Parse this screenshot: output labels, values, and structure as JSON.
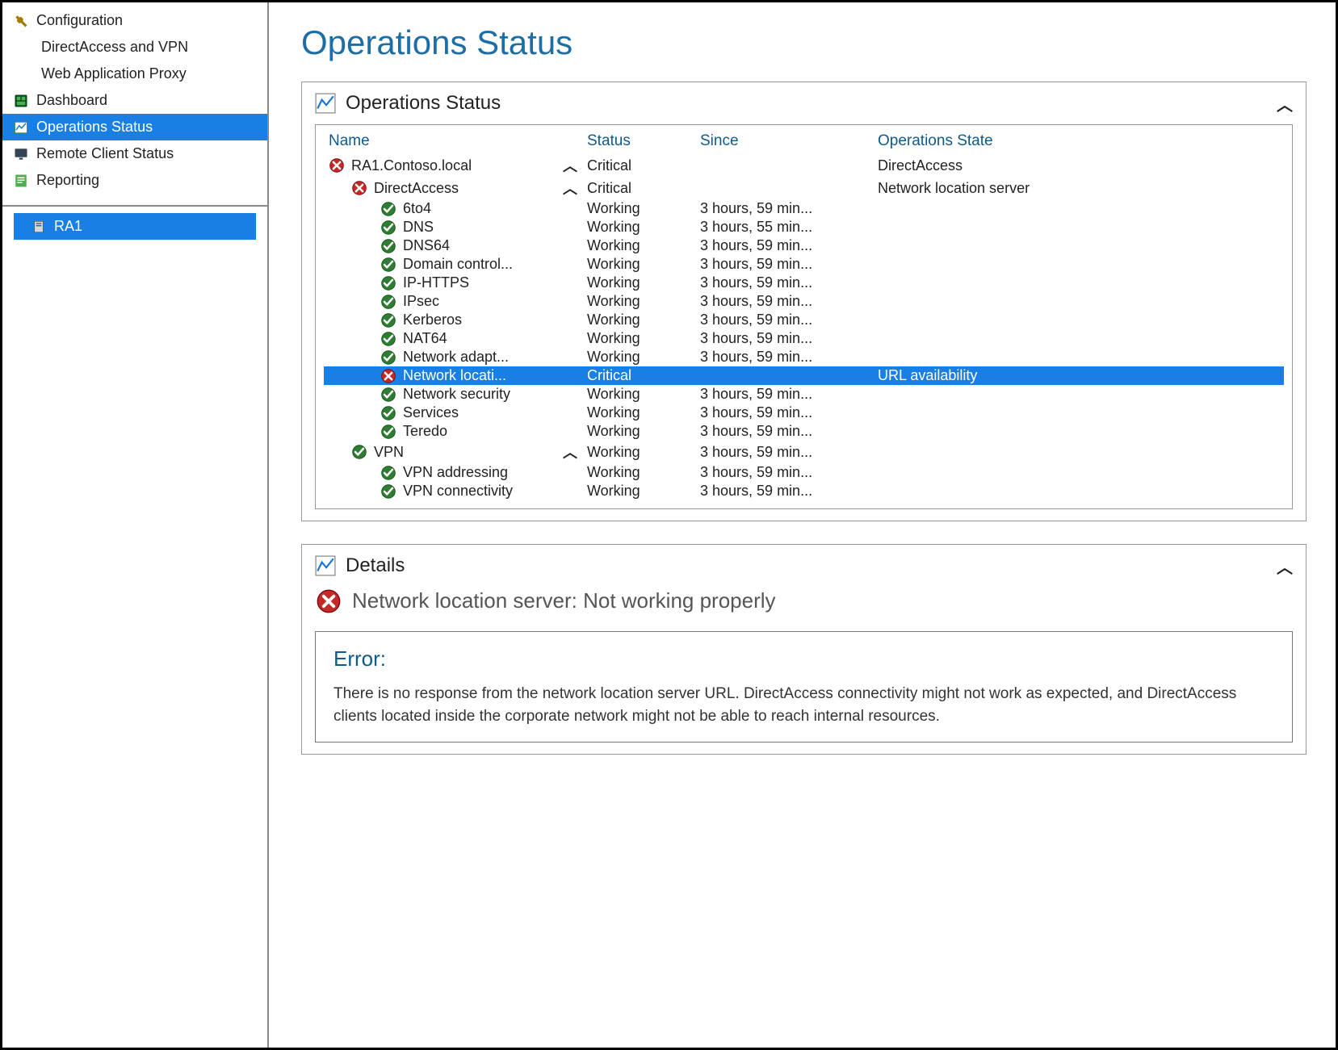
{
  "sidebar": {
    "configuration": {
      "label": "Configuration",
      "children": [
        {
          "label": "DirectAccess and VPN"
        },
        {
          "label": "Web Application Proxy"
        }
      ]
    },
    "items": [
      {
        "label": "Dashboard",
        "iconColor": "#2f7d32",
        "selected": false
      },
      {
        "label": "Operations Status",
        "iconColor": "#2f7d32",
        "selected": true
      },
      {
        "label": "Remote Client Status",
        "iconColor": "#3b5998",
        "selected": false
      },
      {
        "label": "Reporting",
        "iconColor": "#2f7d32",
        "selected": false
      }
    ],
    "servers": [
      {
        "label": "RA1",
        "selected": true
      }
    ]
  },
  "page": {
    "title": "Operations Status"
  },
  "opsPanel": {
    "title": "Operations Status",
    "columns": {
      "name": "Name",
      "status": "Status",
      "since": "Since",
      "state": "Operations State"
    },
    "rows": [
      {
        "indent": 0,
        "icon": "error",
        "name": "RA1.Contoso.local",
        "expand": true,
        "status": "Critical",
        "since": "",
        "state": "DirectAccess"
      },
      {
        "indent": 1,
        "icon": "error",
        "name": "DirectAccess",
        "expand": true,
        "status": "Critical",
        "since": "",
        "state": "Network location server"
      },
      {
        "indent": 2,
        "icon": "ok",
        "name": "6to4",
        "expand": false,
        "status": "Working",
        "since": "3 hours, 59 min...",
        "state": ""
      },
      {
        "indent": 2,
        "icon": "ok",
        "name": "DNS",
        "expand": false,
        "status": "Working",
        "since": "3 hours, 55 min...",
        "state": ""
      },
      {
        "indent": 2,
        "icon": "ok",
        "name": "DNS64",
        "expand": false,
        "status": "Working",
        "since": "3 hours, 59 min...",
        "state": ""
      },
      {
        "indent": 2,
        "icon": "ok",
        "name": "Domain control...",
        "expand": false,
        "status": "Working",
        "since": "3 hours, 59 min...",
        "state": ""
      },
      {
        "indent": 2,
        "icon": "ok",
        "name": "IP-HTTPS",
        "expand": false,
        "status": "Working",
        "since": "3 hours, 59 min...",
        "state": ""
      },
      {
        "indent": 2,
        "icon": "ok",
        "name": "IPsec",
        "expand": false,
        "status": "Working",
        "since": "3 hours, 59 min...",
        "state": ""
      },
      {
        "indent": 2,
        "icon": "ok",
        "name": "Kerberos",
        "expand": false,
        "status": "Working",
        "since": "3 hours, 59 min...",
        "state": ""
      },
      {
        "indent": 2,
        "icon": "ok",
        "name": "NAT64",
        "expand": false,
        "status": "Working",
        "since": "3 hours, 59 min...",
        "state": ""
      },
      {
        "indent": 2,
        "icon": "ok",
        "name": "Network adapt...",
        "expand": false,
        "status": "Working",
        "since": "3 hours, 59 min...",
        "state": ""
      },
      {
        "indent": 2,
        "icon": "error",
        "name": "Network locati...",
        "expand": false,
        "status": "Critical",
        "since": "",
        "state": "URL availability",
        "selected": true
      },
      {
        "indent": 2,
        "icon": "ok",
        "name": "Network security",
        "expand": false,
        "status": "Working",
        "since": "3 hours, 59 min...",
        "state": ""
      },
      {
        "indent": 2,
        "icon": "ok",
        "name": "Services",
        "expand": false,
        "status": "Working",
        "since": "3 hours, 59 min...",
        "state": ""
      },
      {
        "indent": 2,
        "icon": "ok",
        "name": "Teredo",
        "expand": false,
        "status": "Working",
        "since": "3 hours, 59 min...",
        "state": ""
      },
      {
        "indent": 1,
        "icon": "ok",
        "name": "VPN",
        "expand": true,
        "status": "Working",
        "since": "3 hours, 59 min...",
        "state": ""
      },
      {
        "indent": 2,
        "icon": "ok",
        "name": "VPN addressing",
        "expand": false,
        "status": "Working",
        "since": "3 hours, 59 min...",
        "state": ""
      },
      {
        "indent": 2,
        "icon": "ok",
        "name": "VPN connectivity",
        "expand": false,
        "status": "Working",
        "since": "3 hours, 59 min...",
        "state": ""
      }
    ]
  },
  "detailsPanel": {
    "title": "Details",
    "headline": "Network location server: Not working properly",
    "errorHeading": "Error:",
    "errorBody": "There is no response from the network location server URL. DirectAccess connectivity might not work as expected, and DirectAccess clients located inside the corporate network might not be able to reach internal resources."
  }
}
